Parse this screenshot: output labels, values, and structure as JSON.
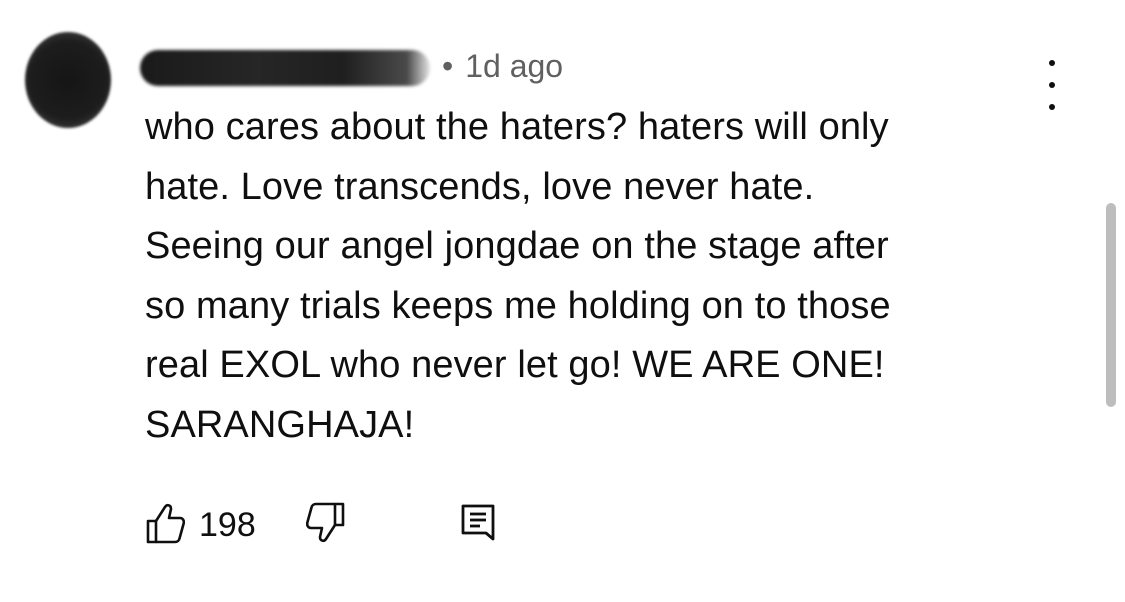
{
  "comment": {
    "timestamp": "1d ago",
    "separator": "•",
    "text_lines": [
      "who cares about the haters? haters will only",
      "hate. Love transcends, love never hate.",
      "Seeing our angel jongdae on the stage after",
      "so many trials keeps me holding on to those",
      "real EXOL who never let go! WE ARE ONE!",
      "SARANGHAJA!"
    ],
    "like_count": "198"
  },
  "icons": {
    "like": "thumbs-up-icon",
    "dislike": "thumbs-down-icon",
    "reply": "reply-comment-icon",
    "more": "more-vertical-icon"
  },
  "colors": {
    "text": "#0f0f0f",
    "meta": "#606060",
    "scrollbar": "#bdbdbd"
  }
}
